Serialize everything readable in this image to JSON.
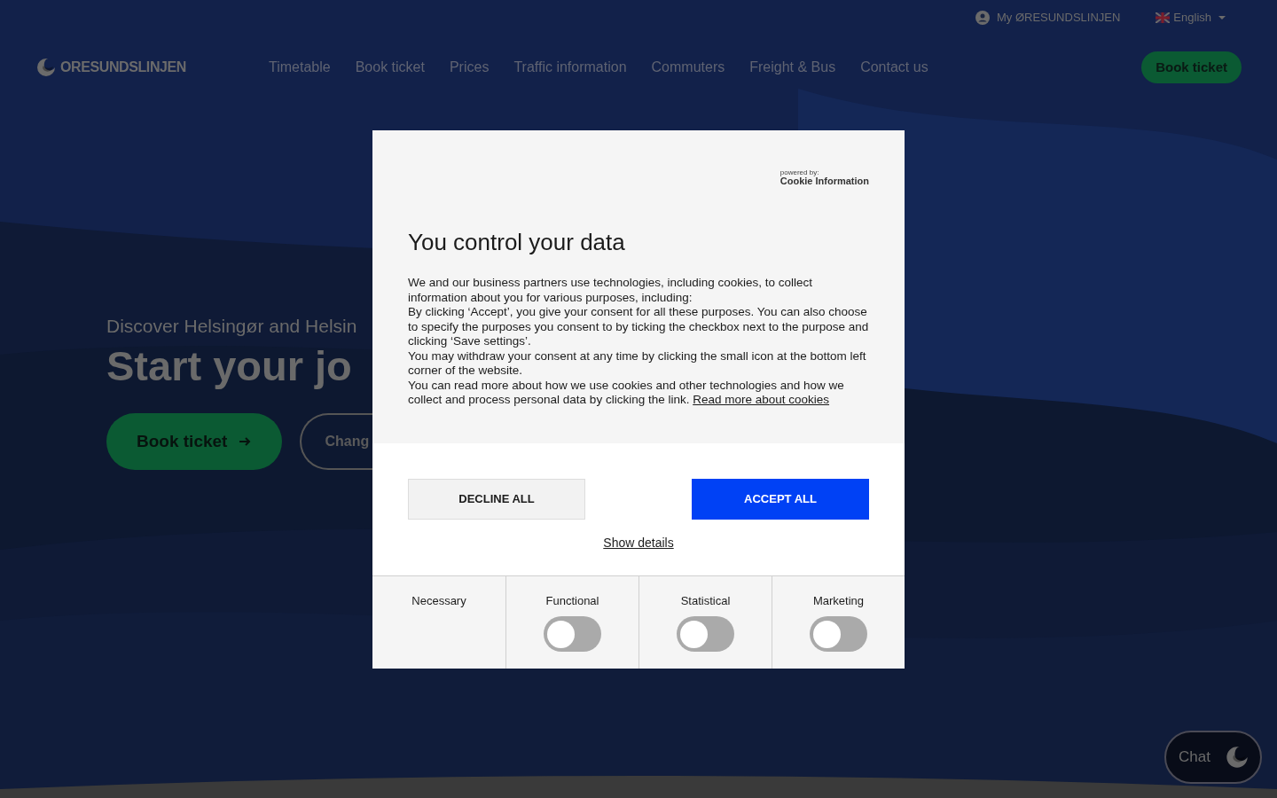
{
  "topbar": {
    "account": "My ØRESUNDSLINJEN",
    "language": "English"
  },
  "header": {
    "logo": "ORESUNDSLINJEN",
    "nav": [
      {
        "label": "Timetable"
      },
      {
        "label": "Book ticket"
      },
      {
        "label": "Prices"
      },
      {
        "label": "Traffic information"
      },
      {
        "label": "Commuters"
      },
      {
        "label": "Freight & Bus"
      },
      {
        "label": "Contact us"
      }
    ],
    "cta": "Book ticket"
  },
  "hero": {
    "kicker": "Discover Helsingør and Helsin",
    "title": "Start your jo",
    "primary": "Book ticket",
    "secondary": "Chang"
  },
  "chat": "Chat",
  "consent": {
    "powered_by": "powered by:",
    "provider": "Cookie Information",
    "title": "You control your data",
    "paragraphs": [
      "We and our business partners use technologies, including cookies, to collect information about you for various purposes, including:",
      "By clicking ‘Accept’, you give your consent for all these purposes. You can also choose to specify the purposes you consent to by ticking the checkbox next to the purpose and clicking ‘Save settings’.",
      "You may withdraw your consent at any time by clicking the small icon at the bottom left corner of the website.",
      "You can read more about how we use cookies and other technologies and how we collect and process personal data by clicking the link."
    ],
    "link": "Read more about cookies",
    "decline": "DECLINE ALL",
    "accept": "ACCEPT ALL",
    "details": "Show details",
    "categories": [
      {
        "label": "Necessary",
        "kind": "fixed"
      },
      {
        "label": "Functional",
        "kind": "toggle",
        "on": false
      },
      {
        "label": "Statistical",
        "kind": "toggle",
        "on": false
      },
      {
        "label": "Marketing",
        "kind": "toggle",
        "on": false
      }
    ]
  }
}
